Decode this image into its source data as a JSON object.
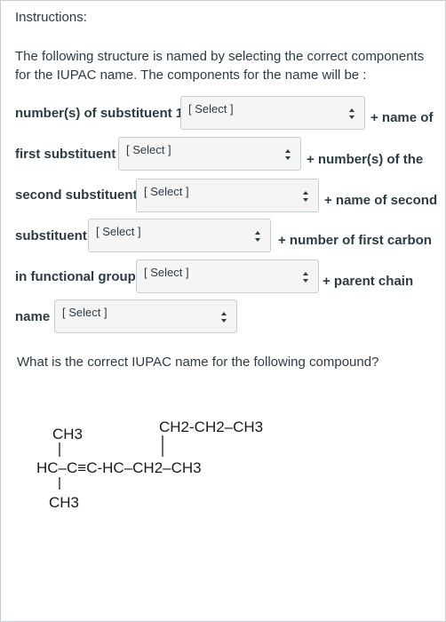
{
  "instructions": {
    "title": "Instructions:",
    "body": "The following structure is named by selecting the correct components for the IUPAC name. The components for the name will be :"
  },
  "rows": [
    {
      "label": "number(s) of substituent 1",
      "select_value": "[ Select ]",
      "suffix": "+ name of"
    },
    {
      "label": "first substituent",
      "select_value": "[ Select ]",
      "suffix": "+ number(s) of the"
    },
    {
      "label": "second substituent",
      "select_value": "[ Select ]",
      "suffix": "+ name of second"
    },
    {
      "label": "substituent",
      "select_value": "[ Select ]",
      "suffix": "+ number of first carbon"
    },
    {
      "label": "in functional group",
      "select_value": "[ Select ]",
      "suffix": "+ parent chain"
    },
    {
      "label": "name",
      "select_value": "[ Select ]",
      "suffix": ""
    }
  ],
  "question": "What is the correct IUPAC name for the following compound?",
  "structure": {
    "top_left": "CH3",
    "top_right": "CH2-CH2–CH3",
    "main_chain": "HC–C≡C-HC–CH2–CH3",
    "bottom_left": "CH3"
  }
}
